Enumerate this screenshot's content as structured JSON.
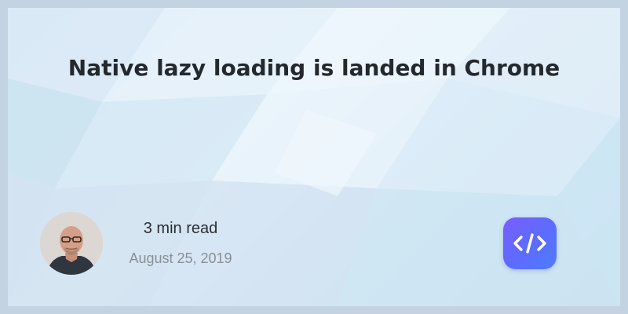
{
  "post": {
    "title": "Native lazy loading is landed in Chrome",
    "read_time": "3 min read",
    "date": "August 25, 2019"
  },
  "author": {
    "avatar_icon": "author-photo"
  },
  "brand": {
    "logo_icon": "code-brackets-icon",
    "logo_colors": [
      "#7b5cff",
      "#4f7bff"
    ]
  },
  "colors": {
    "title": "#24292e",
    "read_time": "#2b2f33",
    "date": "#8a8f96",
    "frame": "#c3d3e2"
  }
}
